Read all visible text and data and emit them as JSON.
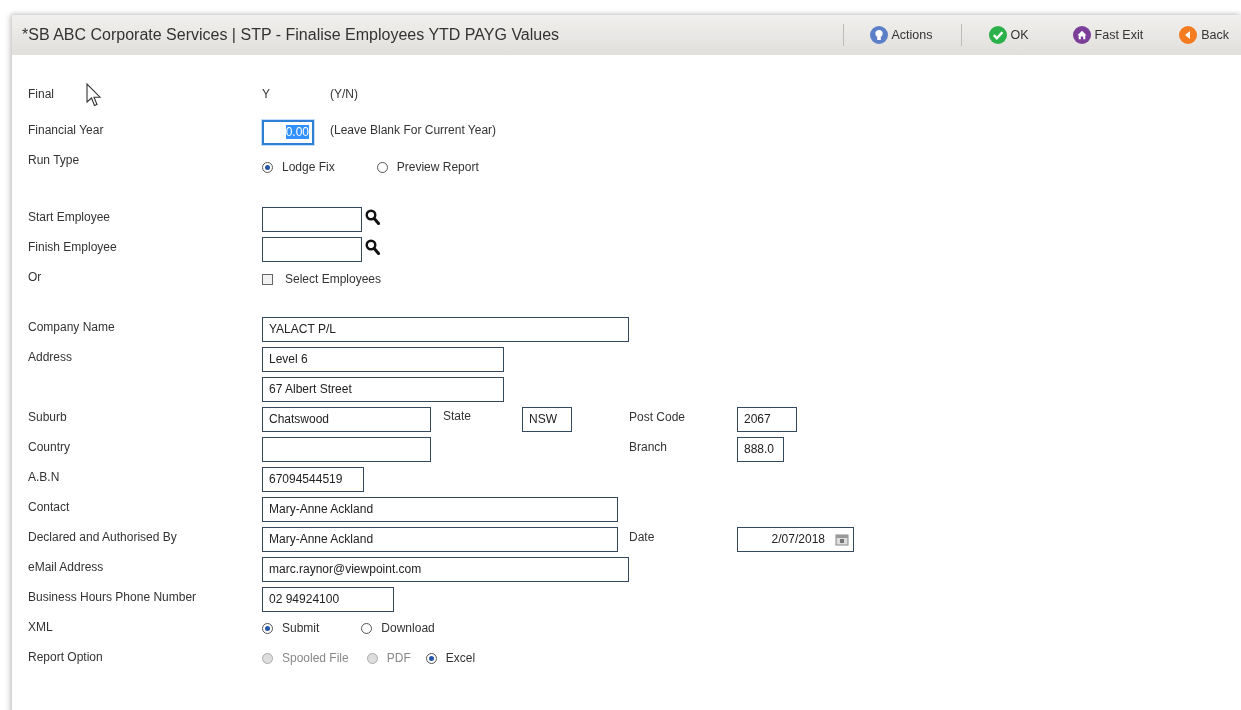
{
  "window": {
    "title": "*SB ABC Corporate Services | STP - Finalise Employees YTD PAYG Values"
  },
  "toolbar": [
    {
      "label": "Actions",
      "kind": "actions"
    },
    {
      "label": "OK",
      "kind": "ok"
    },
    {
      "label": "Fast Exit",
      "kind": "home"
    },
    {
      "label": "Back",
      "kind": "back"
    }
  ],
  "sections": [
    {
      "rows": [
        {
          "label": "Final",
          "kind": "display",
          "value": "Y",
          "hint": "(Y/N)"
        },
        {
          "label": "Financial Year",
          "kind": "input",
          "fields": [
            {
              "value": "0.00",
              "focused": true,
              "hint": "(Leave Blank For Current Year)"
            }
          ]
        },
        {
          "label": "Run Type",
          "kind": "radios",
          "options": [
            {
              "label": "Lodge Fix",
              "selected": true
            },
            {
              "label": "Preview Report",
              "selected": false
            }
          ]
        }
      ]
    },
    {
      "rows": [
        {
          "label": "Start Employee",
          "kind": "lookup"
        },
        {
          "label": "Finish Employee",
          "kind": "lookup"
        },
        {
          "label": "Or",
          "kind": "checkbox",
          "text": "Select Employees",
          "checked": false
        }
      ]
    },
    {
      "rows": [
        {
          "label": "Company Name",
          "kind": "input",
          "fields": [
            {
              "value": "YALACT P/L"
            }
          ]
        },
        {
          "label": "Address",
          "kind": "input",
          "fields": [
            {
              "value": "Level 6"
            }
          ]
        },
        {
          "kind": "input",
          "fields": [
            {
              "value": "67 Albert Street"
            }
          ]
        },
        {
          "label": "Suburb",
          "kind": "input",
          "fields": [
            {
              "value": "Chatswood"
            },
            {
              "label": "State",
              "value": "NSW"
            },
            {
              "label": "Post Code",
              "value": "2067"
            }
          ]
        },
        {
          "label": "Country",
          "kind": "input",
          "fields": [
            {
              "kind": "text"
            },
            {
              "label": "Branch",
              "value": "888.0"
            }
          ]
        },
        {
          "label": "A.B.N",
          "kind": "input",
          "fields": [
            {
              "value": "67094544519"
            }
          ]
        },
        {
          "label": "Contact",
          "kind": "input",
          "fields": [
            {
              "value": "Mary-Anne Ackland"
            }
          ]
        },
        {
          "label": "Declared and Authorised By",
          "kind": "input",
          "fields": [
            {
              "value": "Mary-Anne Ackland"
            },
            {
              "label": "Date",
              "value": "2/07/2018",
              "kind": "date"
            }
          ]
        },
        {
          "label": "eMail Address",
          "kind": "input",
          "fields": [
            {
              "value": "marc.raynor@viewpoint.com"
            }
          ]
        },
        {
          "label": "Business Hours Phone Number",
          "kind": "input",
          "fields": [
            {
              "value": "02 94924100"
            }
          ]
        },
        {
          "label": "XML",
          "kind": "radios",
          "options": [
            {
              "label": "Submit",
              "selected": true
            },
            {
              "label": "Download",
              "selected": false
            }
          ]
        },
        {
          "label": "Report Option",
          "kind": "radios",
          "options": [
            {
              "label": "Spooled File",
              "selected": false,
              "disabled": true
            },
            {
              "label": "PDF",
              "selected": false,
              "disabled": true
            },
            {
              "label": "Excel",
              "selected": true,
              "disabled": false
            }
          ]
        }
      ]
    }
  ]
}
